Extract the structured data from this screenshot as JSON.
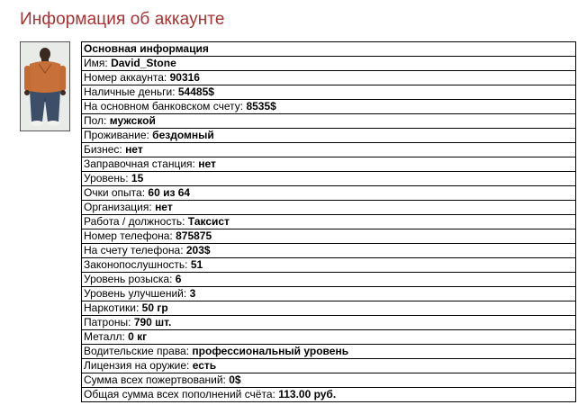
{
  "page": {
    "title": "Информация об аккаунте"
  },
  "section": {
    "header": "Основная информация"
  },
  "rows": [
    {
      "label": "Имя:",
      "value": "David_Stone"
    },
    {
      "label": "Номер аккаунта:",
      "value": "90316"
    },
    {
      "label": "Наличные деньги:",
      "value": "54485$"
    },
    {
      "label": "На основном банковском счету:",
      "value": "8535$"
    },
    {
      "label": "Пол:",
      "value": "мужской"
    },
    {
      "label": "Проживание:",
      "value": "бездомный"
    },
    {
      "label": "Бизнес:",
      "value": "нет"
    },
    {
      "label": "Заправочная станция:",
      "value": "нет"
    },
    {
      "label": "Уровень:",
      "value": "15"
    },
    {
      "label": "Очки опыта:",
      "value": "60 из 64"
    },
    {
      "label": "Организация:",
      "value": "нет"
    },
    {
      "label": "Работа / должность:",
      "value": "Таксист"
    },
    {
      "label": "Номер телефона:",
      "value": "875875"
    },
    {
      "label": "На счету телефона:",
      "value": "203$"
    },
    {
      "label": "Законопослушность:",
      "value": "51"
    },
    {
      "label": "Уровень розыска:",
      "value": "6"
    },
    {
      "label": "Уровень улучшений:",
      "value": "3"
    },
    {
      "label": "Наркотики:",
      "value": "50 гр"
    },
    {
      "label": "Патроны:",
      "value": "790 шт."
    },
    {
      "label": "Металл:",
      "value": "0 кг"
    },
    {
      "label": "Водительские права:",
      "value": "профессиональный уровень"
    },
    {
      "label": "Лицензия на оружие:",
      "value": "есть"
    },
    {
      "label": "Сумма всех пожертвований:",
      "value": "0$"
    },
    {
      "label": "Общая сумма всех пополнений счёта:",
      "value": "113.00 руб."
    }
  ],
  "colors": {
    "title": "#a83232",
    "border": "#000000"
  }
}
